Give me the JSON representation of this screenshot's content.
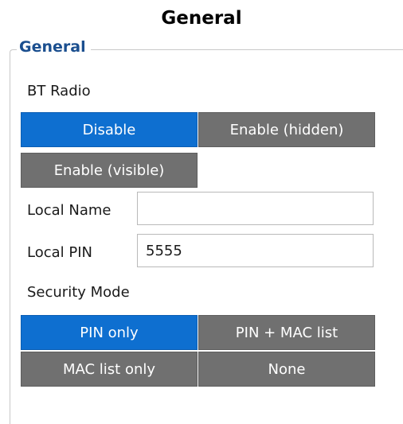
{
  "title": "General",
  "group": {
    "legend": "General"
  },
  "bt_radio": {
    "label": "BT Radio",
    "options": [
      "Disable",
      "Enable (hidden)",
      "Enable (visible)"
    ],
    "selected": "Disable"
  },
  "local_name": {
    "label": "Local Name",
    "value": ""
  },
  "local_pin": {
    "label": "Local PIN",
    "value": "5555"
  },
  "security_mode": {
    "label": "Security Mode",
    "options": [
      "PIN only",
      "PIN + MAC list",
      "MAC list only",
      "None"
    ],
    "selected": "PIN only"
  },
  "colors": {
    "accent": "#0e6fd0",
    "inactive": "#707070",
    "legend": "#1b4f8f"
  }
}
